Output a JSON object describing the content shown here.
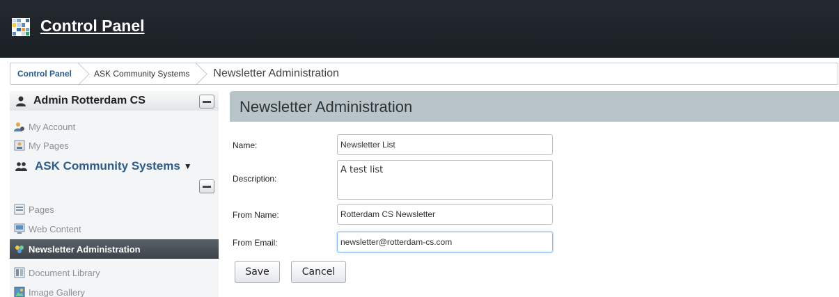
{
  "header": {
    "title": "Control Panel",
    "logo_colors": [
      "#c9d8e8",
      "#7aa3c9",
      "#ffffff",
      "#3e6f9a",
      "#f2c94c",
      "#c9d8e8",
      "#5e8bb3",
      "#ffffff",
      "#ffffff",
      "#3e6f9a",
      "#f2994a",
      "#7aa3c9",
      "#5e8bb3",
      "#ffffff",
      "#c9d8e8",
      "#27ae60"
    ]
  },
  "breadcrumb": {
    "items": [
      "Control Panel",
      "ASK Community Systems",
      "Newsletter Administration"
    ]
  },
  "sidebar": {
    "user_section": {
      "title": "Admin Rotterdam CS",
      "icon": "user-icon",
      "items": [
        {
          "label": "My Account",
          "icon": "my-account-icon"
        },
        {
          "label": "My Pages",
          "icon": "my-pages-icon"
        }
      ]
    },
    "community_section": {
      "title": "ASK Community Systems",
      "dropdown_glyph": "▼",
      "icon": "group-icon",
      "items": [
        {
          "label": "Pages",
          "icon": "pages-icon"
        },
        {
          "label": "Web Content",
          "icon": "web-content-icon"
        },
        {
          "label": "Newsletter Administration",
          "icon": "newsletter-icon",
          "active": true
        },
        {
          "label": "Document Library",
          "icon": "document-library-icon"
        },
        {
          "label": "Image Gallery",
          "icon": "image-gallery-icon"
        }
      ]
    }
  },
  "main": {
    "title": "Newsletter Administration",
    "form": {
      "name_label": "Name:",
      "name_value": "Newsletter List",
      "description_label": "Description:",
      "description_value": "A test list",
      "from_name_label": "From Name:",
      "from_name_value": "Rotterdam CS Newsletter",
      "from_email_label": "From Email:",
      "from_email_value": "newsletter@rotterdam-cs.com"
    },
    "save_label": "Save",
    "cancel_label": "Cancel"
  },
  "colors": {
    "header_bg": "#1f252a",
    "accent_blue": "#2c5d8a",
    "panel_header_bg": "#b9c4c8",
    "active_item_bg": "#4a5158"
  }
}
